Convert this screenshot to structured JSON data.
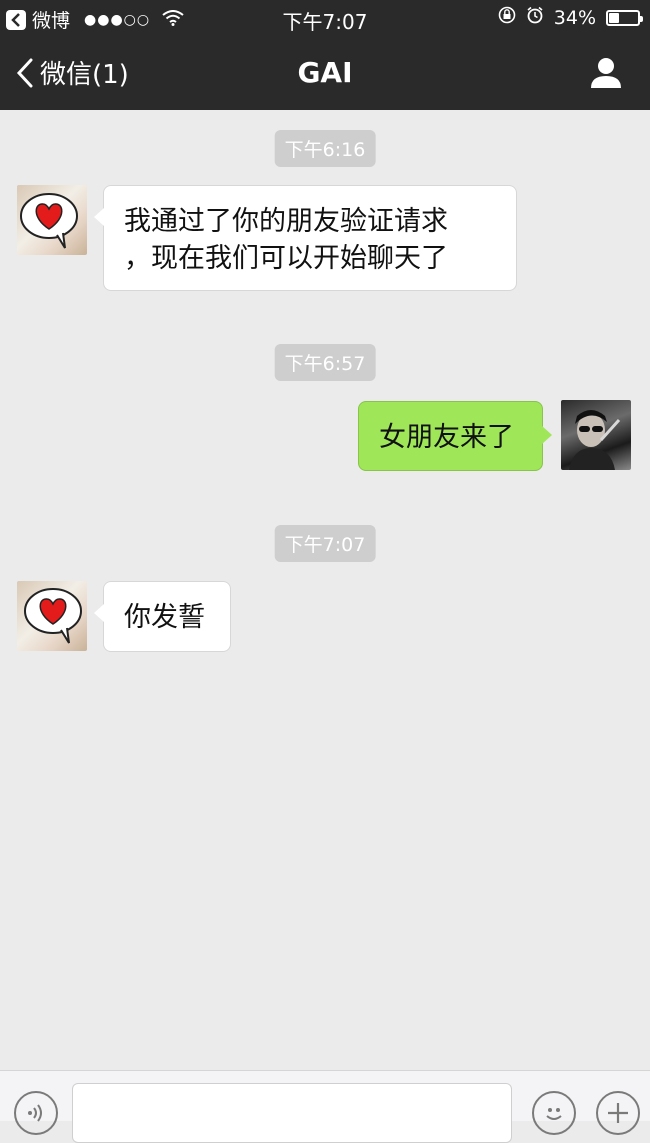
{
  "status_bar": {
    "back_app_label": "微博",
    "signal": "●●●○○",
    "time": "下午7:07",
    "battery_text": "34%",
    "battery_level": 0.34
  },
  "nav": {
    "back_label": "微信(1)",
    "title": "GAI"
  },
  "messages": [
    {
      "type": "timestamp",
      "text": "下午6:16"
    },
    {
      "type": "incoming",
      "lines": [
        "我通过了你的朋友验证请求",
        "，现在我们可以开始聊天了"
      ]
    },
    {
      "type": "timestamp",
      "text": "下午6:57"
    },
    {
      "type": "outgoing",
      "text": "女朋友来了"
    },
    {
      "type": "timestamp",
      "text": "下午7:07"
    },
    {
      "type": "incoming",
      "text": "你发誓"
    }
  ],
  "icons": {
    "app_back": "chevron-left-icon",
    "wifi": "wifi-icon",
    "lock": "rotation-lock-icon",
    "alarm": "alarm-icon",
    "profile": "person-icon",
    "voice": "voice-icon",
    "emoji": "emoji-icon",
    "plus": "plus-icon"
  },
  "colors": {
    "nav_background": "#2a2a2a",
    "chat_background": "#ebebeb",
    "outgoing_bubble": "#9fe658",
    "incoming_bubble": "#ffffff",
    "timestamp_pill": "#cecece"
  }
}
